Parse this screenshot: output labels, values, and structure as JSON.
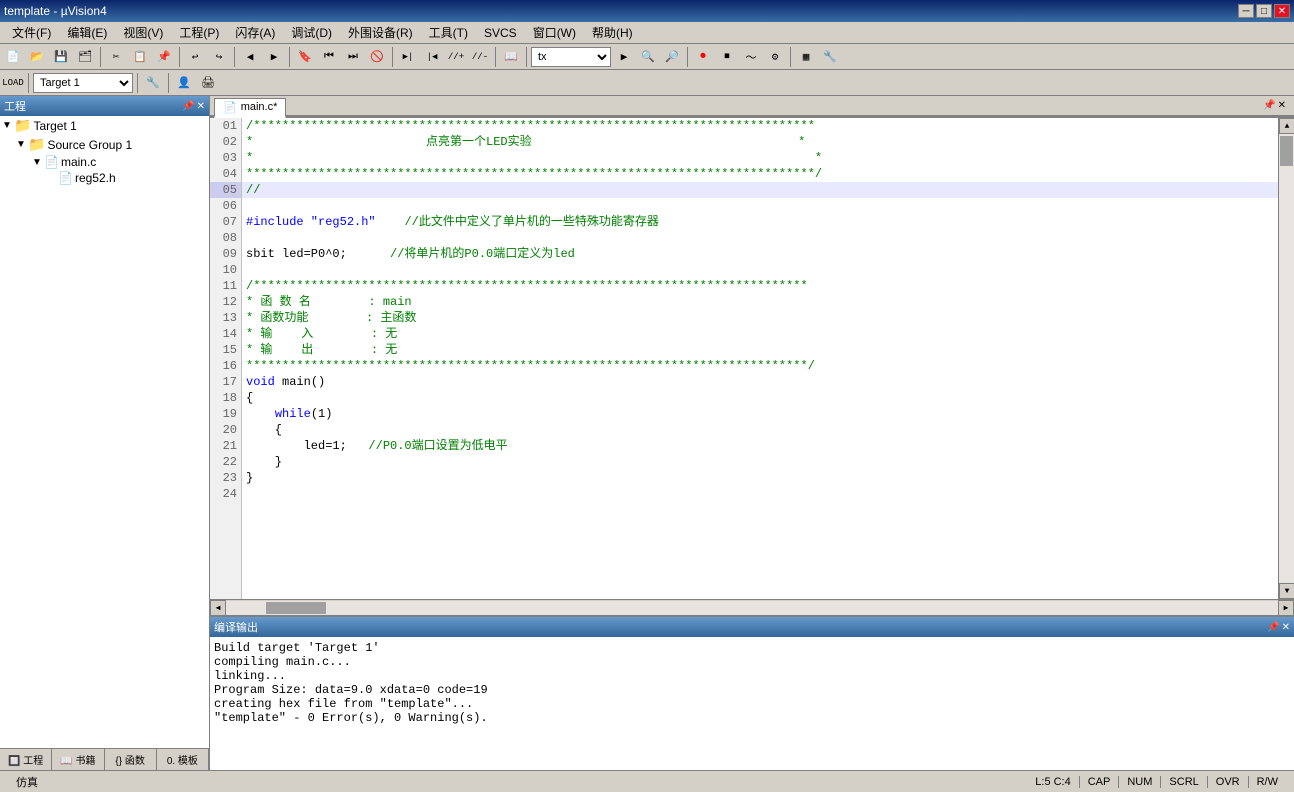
{
  "titlebar": {
    "title": "template - µVision4",
    "minimize_label": "─",
    "restore_label": "□",
    "close_label": "✕"
  },
  "menubar": {
    "items": [
      {
        "label": "文件(F)"
      },
      {
        "label": "编辑(E)"
      },
      {
        "label": "视图(V)"
      },
      {
        "label": "工程(P)"
      },
      {
        "label": "闪存(A)"
      },
      {
        "label": "调试(D)"
      },
      {
        "label": "外围设备(R)"
      },
      {
        "label": "工具(T)"
      },
      {
        "label": "SVCS"
      },
      {
        "label": "窗口(W)"
      },
      {
        "label": "帮助(H)"
      }
    ]
  },
  "toolbar1": {
    "combo_value": "tx",
    "target_combo": "Target 1"
  },
  "project_panel": {
    "header": "工程",
    "tree": {
      "target": "Target 1",
      "group": "Source Group 1",
      "files": [
        "main.c",
        "reg52.h"
      ]
    },
    "tabs": [
      {
        "label": "工程",
        "icon": "🔲"
      },
      {
        "label": "书籍",
        "icon": "📖"
      },
      {
        "label": "函数",
        "icon": "{}"
      },
      {
        "label": "模板",
        "icon": "0,"
      }
    ]
  },
  "editor": {
    "tab_label": "main.c",
    "tab_modified": true,
    "lines": [
      {
        "num": "01",
        "content": "/*******************************************************************************",
        "class": "c-comment"
      },
      {
        "num": "02",
        "content": "*                        点亮第一个LED实验                                     *",
        "class": "c-comment"
      },
      {
        "num": "03",
        "content": "*                                                                              *",
        "class": "c-comment"
      },
      {
        "num": "04",
        "content": "*******************************************************************************/",
        "class": "c-comment"
      },
      {
        "num": "05",
        "content": "//",
        "class": "c-comment",
        "highlight": true
      },
      {
        "num": "06",
        "content": "",
        "class": "c-normal"
      },
      {
        "num": "07",
        "content": "#include \"reg52.h\"    //此文件中定义了单片机的一些特殊功能寄存器",
        "class": "mixed"
      },
      {
        "num": "08",
        "content": "",
        "class": "c-normal"
      },
      {
        "num": "09",
        "content": "sbit led=P0^0;      //将单片机的P0.0端口定义为led",
        "class": "mixed"
      },
      {
        "num": "10",
        "content": "",
        "class": "c-normal"
      },
      {
        "num": "11",
        "content": "/*****************************************************************************",
        "class": "c-comment"
      },
      {
        "num": "12",
        "content": "* 函 数 名        : main",
        "class": "c-comment"
      },
      {
        "num": "13",
        "content": "* 函数功能        : 主函数",
        "class": "c-comment"
      },
      {
        "num": "14",
        "content": "* 输    入        : 无",
        "class": "c-comment"
      },
      {
        "num": "15",
        "content": "* 输    出        : 无",
        "class": "c-comment"
      },
      {
        "num": "16",
        "content": "******************************************************************************/",
        "class": "c-comment"
      },
      {
        "num": "17",
        "content": "void main()",
        "class": "c-keyword"
      },
      {
        "num": "18",
        "content": "{",
        "class": "c-normal",
        "has_expand": true
      },
      {
        "num": "19",
        "content": "    while(1)",
        "class": "mixed"
      },
      {
        "num": "20",
        "content": "    {",
        "class": "c-normal"
      },
      {
        "num": "21",
        "content": "        led=1;   //P0.0端口设置为低电平",
        "class": "mixed"
      },
      {
        "num": "22",
        "content": "    }",
        "class": "c-normal"
      },
      {
        "num": "23",
        "content": "}",
        "class": "c-normal"
      },
      {
        "num": "24",
        "content": "",
        "class": "c-normal"
      }
    ]
  },
  "output_panel": {
    "header": "编译输出",
    "lines": [
      "Build target 'Target 1'",
      "compiling main.c...",
      "linking...",
      "Program Size: data=9.0 xdata=0 code=19",
      "creating hex file from \"template\"...",
      "\"template\" - 0 Error(s), 0 Warning(s)."
    ]
  },
  "statusbar": {
    "sim_label": "仿真",
    "position": "L:5 C:4",
    "caps": "CAP",
    "num": "NUM",
    "scrl": "SCRL",
    "ovr": "OVR",
    "rw": "R/W"
  }
}
